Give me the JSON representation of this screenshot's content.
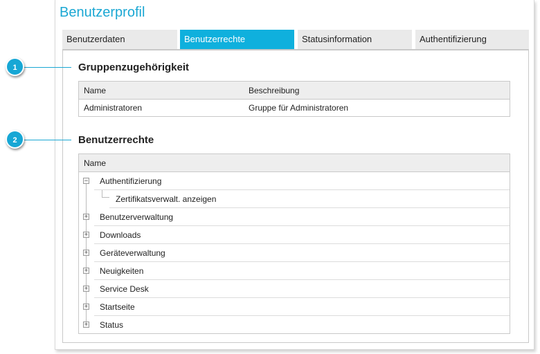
{
  "app": {
    "title": "Benutzerprofil"
  },
  "tabs": [
    {
      "label": "Benutzerdaten",
      "active": false
    },
    {
      "label": "Benutzerrechte",
      "active": true
    },
    {
      "label": "Statusinformation",
      "active": false
    },
    {
      "label": "Authentifizierung",
      "active": false
    }
  ],
  "callouts": [
    "1",
    "2"
  ],
  "groups": {
    "title": "Gruppenzugehörigkeit",
    "columns": [
      "Name",
      "Beschreibung"
    ],
    "rows": [
      [
        "Administratoren",
        "Gruppe für Administratoren"
      ]
    ]
  },
  "rights": {
    "title": "Benutzerrechte",
    "column": "Name",
    "items": [
      {
        "label": "Authentifizierung",
        "expanded": true,
        "children": [
          "Zertifikatsverwalt. anzeigen"
        ]
      },
      {
        "label": "Benutzerverwaltung",
        "expanded": false
      },
      {
        "label": "Downloads",
        "expanded": false
      },
      {
        "label": "Geräteverwaltung",
        "expanded": false
      },
      {
        "label": "Neuigkeiten",
        "expanded": false
      },
      {
        "label": "Service Desk",
        "expanded": false
      },
      {
        "label": "Startseite",
        "expanded": false
      },
      {
        "label": "Status",
        "expanded": false
      }
    ]
  },
  "colors": {
    "accent": "#1aa7d3",
    "active_tab": "#0fb0dd"
  }
}
